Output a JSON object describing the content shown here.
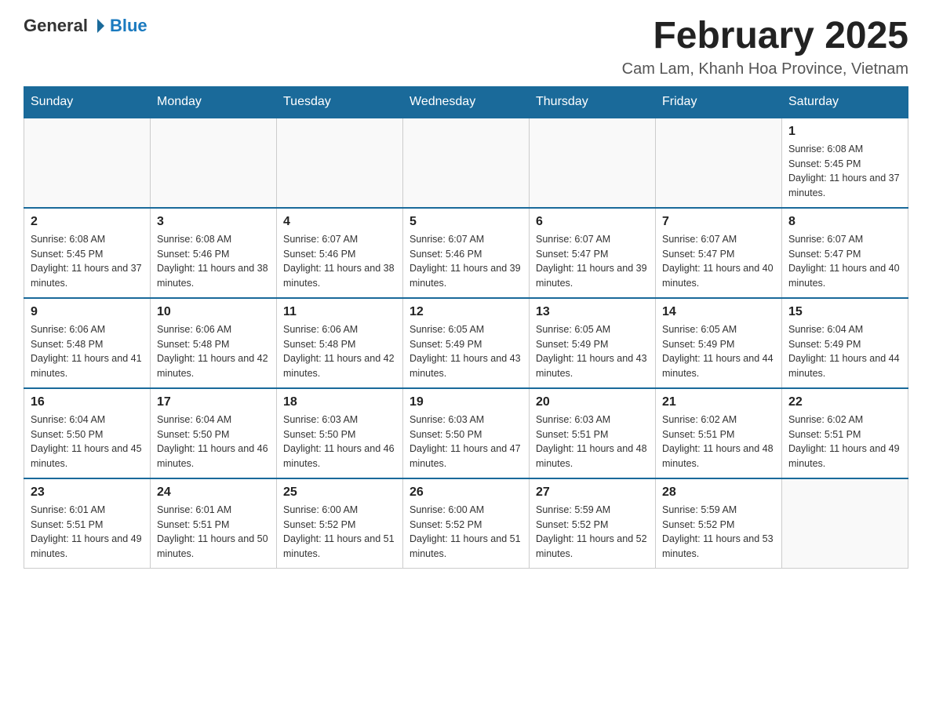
{
  "header": {
    "logo_general": "General",
    "logo_blue": "Blue",
    "title": "February 2025",
    "subtitle": "Cam Lam, Khanh Hoa Province, Vietnam"
  },
  "days_of_week": [
    "Sunday",
    "Monday",
    "Tuesday",
    "Wednesday",
    "Thursday",
    "Friday",
    "Saturday"
  ],
  "weeks": [
    [
      {
        "day": "",
        "info": ""
      },
      {
        "day": "",
        "info": ""
      },
      {
        "day": "",
        "info": ""
      },
      {
        "day": "",
        "info": ""
      },
      {
        "day": "",
        "info": ""
      },
      {
        "day": "",
        "info": ""
      },
      {
        "day": "1",
        "info": "Sunrise: 6:08 AM\nSunset: 5:45 PM\nDaylight: 11 hours and 37 minutes."
      }
    ],
    [
      {
        "day": "2",
        "info": "Sunrise: 6:08 AM\nSunset: 5:45 PM\nDaylight: 11 hours and 37 minutes."
      },
      {
        "day": "3",
        "info": "Sunrise: 6:08 AM\nSunset: 5:46 PM\nDaylight: 11 hours and 38 minutes."
      },
      {
        "day": "4",
        "info": "Sunrise: 6:07 AM\nSunset: 5:46 PM\nDaylight: 11 hours and 38 minutes."
      },
      {
        "day": "5",
        "info": "Sunrise: 6:07 AM\nSunset: 5:46 PM\nDaylight: 11 hours and 39 minutes."
      },
      {
        "day": "6",
        "info": "Sunrise: 6:07 AM\nSunset: 5:47 PM\nDaylight: 11 hours and 39 minutes."
      },
      {
        "day": "7",
        "info": "Sunrise: 6:07 AM\nSunset: 5:47 PM\nDaylight: 11 hours and 40 minutes."
      },
      {
        "day": "8",
        "info": "Sunrise: 6:07 AM\nSunset: 5:47 PM\nDaylight: 11 hours and 40 minutes."
      }
    ],
    [
      {
        "day": "9",
        "info": "Sunrise: 6:06 AM\nSunset: 5:48 PM\nDaylight: 11 hours and 41 minutes."
      },
      {
        "day": "10",
        "info": "Sunrise: 6:06 AM\nSunset: 5:48 PM\nDaylight: 11 hours and 42 minutes."
      },
      {
        "day": "11",
        "info": "Sunrise: 6:06 AM\nSunset: 5:48 PM\nDaylight: 11 hours and 42 minutes."
      },
      {
        "day": "12",
        "info": "Sunrise: 6:05 AM\nSunset: 5:49 PM\nDaylight: 11 hours and 43 minutes."
      },
      {
        "day": "13",
        "info": "Sunrise: 6:05 AM\nSunset: 5:49 PM\nDaylight: 11 hours and 43 minutes."
      },
      {
        "day": "14",
        "info": "Sunrise: 6:05 AM\nSunset: 5:49 PM\nDaylight: 11 hours and 44 minutes."
      },
      {
        "day": "15",
        "info": "Sunrise: 6:04 AM\nSunset: 5:49 PM\nDaylight: 11 hours and 44 minutes."
      }
    ],
    [
      {
        "day": "16",
        "info": "Sunrise: 6:04 AM\nSunset: 5:50 PM\nDaylight: 11 hours and 45 minutes."
      },
      {
        "day": "17",
        "info": "Sunrise: 6:04 AM\nSunset: 5:50 PM\nDaylight: 11 hours and 46 minutes."
      },
      {
        "day": "18",
        "info": "Sunrise: 6:03 AM\nSunset: 5:50 PM\nDaylight: 11 hours and 46 minutes."
      },
      {
        "day": "19",
        "info": "Sunrise: 6:03 AM\nSunset: 5:50 PM\nDaylight: 11 hours and 47 minutes."
      },
      {
        "day": "20",
        "info": "Sunrise: 6:03 AM\nSunset: 5:51 PM\nDaylight: 11 hours and 48 minutes."
      },
      {
        "day": "21",
        "info": "Sunrise: 6:02 AM\nSunset: 5:51 PM\nDaylight: 11 hours and 48 minutes."
      },
      {
        "day": "22",
        "info": "Sunrise: 6:02 AM\nSunset: 5:51 PM\nDaylight: 11 hours and 49 minutes."
      }
    ],
    [
      {
        "day": "23",
        "info": "Sunrise: 6:01 AM\nSunset: 5:51 PM\nDaylight: 11 hours and 49 minutes."
      },
      {
        "day": "24",
        "info": "Sunrise: 6:01 AM\nSunset: 5:51 PM\nDaylight: 11 hours and 50 minutes."
      },
      {
        "day": "25",
        "info": "Sunrise: 6:00 AM\nSunset: 5:52 PM\nDaylight: 11 hours and 51 minutes."
      },
      {
        "day": "26",
        "info": "Sunrise: 6:00 AM\nSunset: 5:52 PM\nDaylight: 11 hours and 51 minutes."
      },
      {
        "day": "27",
        "info": "Sunrise: 5:59 AM\nSunset: 5:52 PM\nDaylight: 11 hours and 52 minutes."
      },
      {
        "day": "28",
        "info": "Sunrise: 5:59 AM\nSunset: 5:52 PM\nDaylight: 11 hours and 53 minutes."
      },
      {
        "day": "",
        "info": ""
      }
    ]
  ]
}
